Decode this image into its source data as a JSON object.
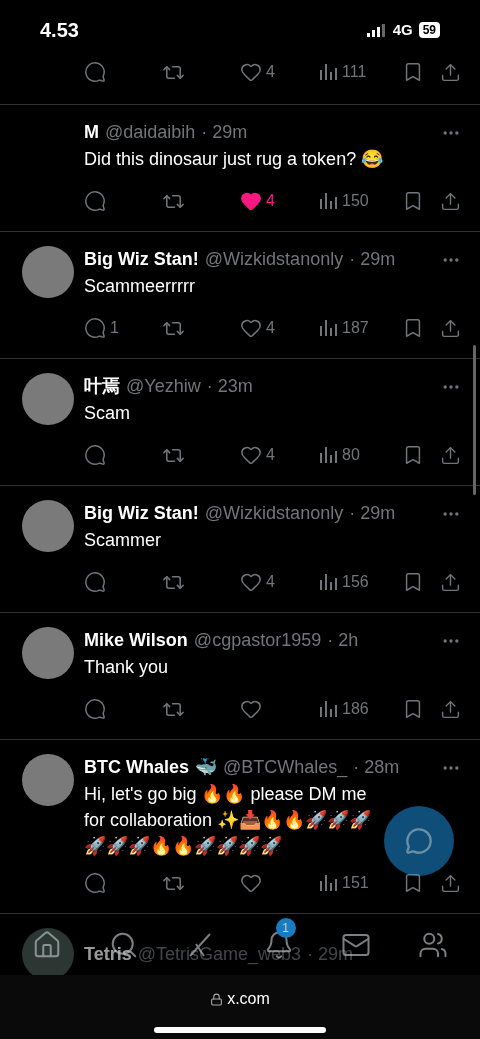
{
  "status_bar": {
    "time": "4.53",
    "network": "4G",
    "battery": "59"
  },
  "top_actions": {
    "likes": "4",
    "views": "111"
  },
  "tweets": [
    {
      "avatar": false,
      "name": "M",
      "handle": "@daidaibih",
      "time": "· 29m",
      "text": "Did this dinosaur just rug a token? 😂",
      "likes": "4",
      "liked": true,
      "views": "150"
    },
    {
      "avatar": true,
      "name": "Big Wiz Stan!",
      "handle": "@Wizkidstanonly",
      "time": "· 29m",
      "text": "Scammeerrrrr",
      "replies": "1",
      "likes": "4",
      "liked": false,
      "views": "187"
    },
    {
      "avatar": true,
      "name": "叶焉",
      "handle": "@Yezhiw",
      "time": "· 23m",
      "text": "Scam",
      "likes": "4",
      "liked": false,
      "views": "80"
    },
    {
      "avatar": true,
      "name": "Big Wiz Stan!",
      "handle": "@Wizkidstanonly",
      "time": "· 29m",
      "text": "Scammer",
      "likes": "4",
      "liked": false,
      "views": "156"
    },
    {
      "avatar": true,
      "name": "Mike Wilson",
      "handle": "@cgpastor1959",
      "time": "· 2h",
      "text": "Thank you",
      "liked": false,
      "views": "186"
    },
    {
      "avatar": true,
      "name": "BTC Whales",
      "name_emoji": "🐳",
      "handle": "@BTCWhales_",
      "time": "· 28m",
      "text": "Hi, let's go big 🔥🔥 please DM me for collaboration ✨📥🔥🔥🚀🚀🚀🚀🚀🚀🔥🔥🚀🚀🚀🚀",
      "liked": false,
      "views": "151"
    }
  ],
  "partial_tweet": {
    "name": "Tetris",
    "handle": "@TetrisGame_web3",
    "time": "· 29m"
  },
  "bottom_nav": [
    {
      "kind": "home"
    },
    {
      "kind": "search"
    },
    {
      "kind": "grok"
    },
    {
      "kind": "notifications",
      "badge": "1"
    },
    {
      "kind": "messages"
    },
    {
      "kind": "communities"
    }
  ],
  "browser_bar": {
    "url": "x.com"
  }
}
